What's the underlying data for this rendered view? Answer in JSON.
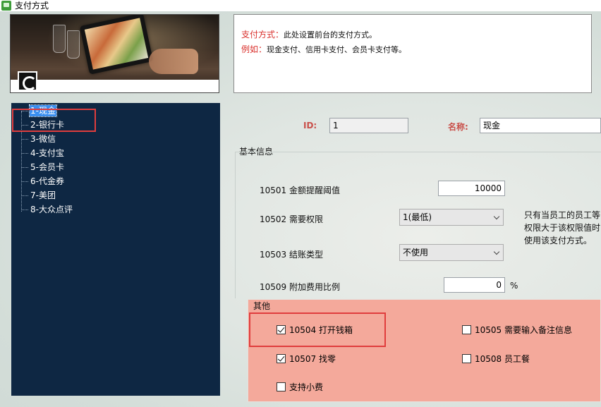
{
  "window": {
    "title": "支付方式"
  },
  "info": {
    "line1_key": "支付方式：",
    "line1_text": "此处设置前台的支付方式。",
    "line2_key": "例如：",
    "line2_text": "现金支付、信用卡支付、会员卡支付等。"
  },
  "tree": {
    "items": [
      {
        "label": "1-现金",
        "selected": true
      },
      {
        "label": "2-银行卡"
      },
      {
        "label": "3-微信"
      },
      {
        "label": "4-支付宝"
      },
      {
        "label": "5-会员卡"
      },
      {
        "label": "6-代金券"
      },
      {
        "label": "7-美团"
      },
      {
        "label": "8-大众点评"
      }
    ]
  },
  "form": {
    "id_label": "ID:",
    "id_value": "1",
    "name_label": "名称:",
    "name_value": "现金",
    "basic_group": "基本信息",
    "rows": {
      "r10501_label": "10501 金额提醒阈值",
      "r10501_value": "10000",
      "r10502_label": "10502 需要权限",
      "r10502_value": "1(最低)",
      "r10503_label": "10503 结账类型",
      "r10503_value": "不使用",
      "r10509_label": "10509 附加费用比例",
      "r10509_value": "0",
      "r10509_unit": "%"
    },
    "hint_lines": [
      "只有当员工的员工等",
      "权限大于该权限值时",
      "使用该支付方式。"
    ],
    "other_group": "其他",
    "checks": {
      "c10504": {
        "label": "10504 打开钱箱",
        "checked": true
      },
      "c10505": {
        "label": "10505 需要输入备注信息",
        "checked": false
      },
      "c10507": {
        "label": "10507 找零",
        "checked": true
      },
      "c10508": {
        "label": "10508 员工餐",
        "checked": false
      },
      "tip": {
        "label": "支持小费",
        "checked": false
      }
    }
  },
  "colors": {
    "tree_bg": "#0e2743",
    "tree_selected": "#3a8ff0",
    "accent_red": "#d9302c",
    "highlight_box": "#e03d3d",
    "other_group_bg": "#f4a99b"
  }
}
